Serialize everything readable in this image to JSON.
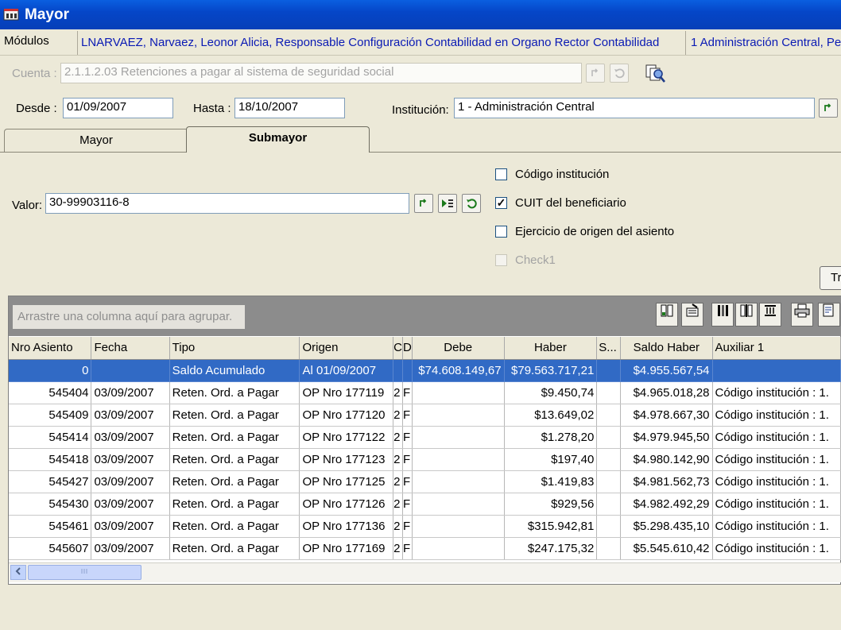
{
  "window": {
    "title": "Mayor"
  },
  "modules": {
    "label": "Módulos",
    "user": "LNARVAEZ, Narvaez, Leonor Alicia, Responsable Configuración Contabilidad en Organo Rector Contabilidad",
    "institution": "1 Administración Central, Pe"
  },
  "filters": {
    "cuenta_label": "Cuenta :",
    "cuenta_value": "2.1.1.2.03 Retenciones a pagar al sistema de seguridad social",
    "desde_label": "Desde :",
    "desde_value": "01/09/2007",
    "hasta_label": "Hasta :",
    "hasta_value": "18/10/2007",
    "institucion_label": "Institución:",
    "institucion_value": "1 - Administración Central"
  },
  "tabs": [
    {
      "label": "Mayor"
    },
    {
      "label": "Submayor"
    }
  ],
  "submayor": {
    "valor_label": "Valor:",
    "valor_value": "30-99903116-8",
    "checkboxes": [
      {
        "label": "Código institución",
        "checked": false,
        "mark": ""
      },
      {
        "label": "CUIT del beneficiario",
        "checked": true,
        "mark": "✓"
      },
      {
        "label": "Ejercicio de origen del asiento",
        "checked": false,
        "mark": ""
      },
      {
        "label": "Check1",
        "checked": false,
        "mark": ""
      }
    ],
    "side_button": "Tr"
  },
  "grid": {
    "group_hint": "Arrastre una columna aquí para agrupar.",
    "columns": [
      "Nro Asiento",
      "Fecha",
      "Tipo",
      "Origen",
      "C",
      "D",
      "Debe",
      "Haber",
      "S...",
      "Saldo Haber",
      "Auxiliar 1"
    ],
    "rows": [
      {
        "nro": "0",
        "fecha": "",
        "tipo": "Saldo Acumulado",
        "origen": "Al 01/09/2007",
        "c": "",
        "d": "",
        "debe": "$74.608.149,67",
        "haber": "$79.563.717,21",
        "s": "",
        "saldo": "$4.955.567,54",
        "aux": ""
      },
      {
        "nro": "545404",
        "fecha": "03/09/2007",
        "tipo": "Reten. Ord. a Pagar",
        "origen": "OP Nro 177119",
        "c": "2",
        "d": "F",
        "debe": "",
        "haber": "$9.450,74",
        "s": "",
        "saldo": "$4.965.018,28",
        "aux": "Código institución : 1."
      },
      {
        "nro": "545409",
        "fecha": "03/09/2007",
        "tipo": "Reten. Ord. a Pagar",
        "origen": "OP Nro 177120",
        "c": "2",
        "d": "F",
        "debe": "",
        "haber": "$13.649,02",
        "s": "",
        "saldo": "$4.978.667,30",
        "aux": "Código institución : 1."
      },
      {
        "nro": "545414",
        "fecha": "03/09/2007",
        "tipo": "Reten. Ord. a Pagar",
        "origen": "OP Nro 177122",
        "c": "2",
        "d": "F",
        "debe": "",
        "haber": "$1.278,20",
        "s": "",
        "saldo": "$4.979.945,50",
        "aux": "Código institución : 1."
      },
      {
        "nro": "545418",
        "fecha": "03/09/2007",
        "tipo": "Reten. Ord. a Pagar",
        "origen": "OP Nro 177123",
        "c": "2",
        "d": "F",
        "debe": "",
        "haber": "$197,40",
        "s": "",
        "saldo": "$4.980.142,90",
        "aux": "Código institución : 1."
      },
      {
        "nro": "545427",
        "fecha": "03/09/2007",
        "tipo": "Reten. Ord. a Pagar",
        "origen": "OP Nro 177125",
        "c": "2",
        "d": "F",
        "debe": "",
        "haber": "$1.419,83",
        "s": "",
        "saldo": "$4.981.562,73",
        "aux": "Código institución : 1."
      },
      {
        "nro": "545430",
        "fecha": "03/09/2007",
        "tipo": "Reten. Ord. a Pagar",
        "origen": "OP Nro 177126",
        "c": "2",
        "d": "F",
        "debe": "",
        "haber": "$929,56",
        "s": "",
        "saldo": "$4.982.492,29",
        "aux": "Código institución : 1."
      },
      {
        "nro": "545461",
        "fecha": "03/09/2007",
        "tipo": "Reten. Ord. a Pagar",
        "origen": "OP Nro 177136",
        "c": "2",
        "d": "F",
        "debe": "",
        "haber": "$315.942,81",
        "s": "",
        "saldo": "$5.298.435,10",
        "aux": "Código institución : 1."
      },
      {
        "nro": "545607",
        "fecha": "03/09/2007",
        "tipo": "Reten. Ord. a Pagar",
        "origen": "OP Nro 177169",
        "c": "2",
        "d": "F",
        "debe": "",
        "haber": "$247.175,32",
        "s": "",
        "saldo": "$5.545.610,42",
        "aux": "Código institución : 1."
      }
    ]
  },
  "icons": {
    "cuenta_search": "search-arrow-icon",
    "cuenta_undo": "undo-icon",
    "cuenta_find": "find-document-icon",
    "inst_search": "search-arrow-icon",
    "valor_search": "search-arrow-icon",
    "valor_play_list": "play-list-icon",
    "valor_undo": "undo-icon",
    "toolbar": [
      "column-chooser-icon",
      "edit-grid-icon",
      "columns-left-icon",
      "columns-split-icon",
      "columns-fit-icon",
      "print-icon",
      "export-icon"
    ]
  },
  "colors": {
    "title_bar": "#0546c8",
    "module_text": "#0a1ab4",
    "selection": "#316ac5"
  }
}
